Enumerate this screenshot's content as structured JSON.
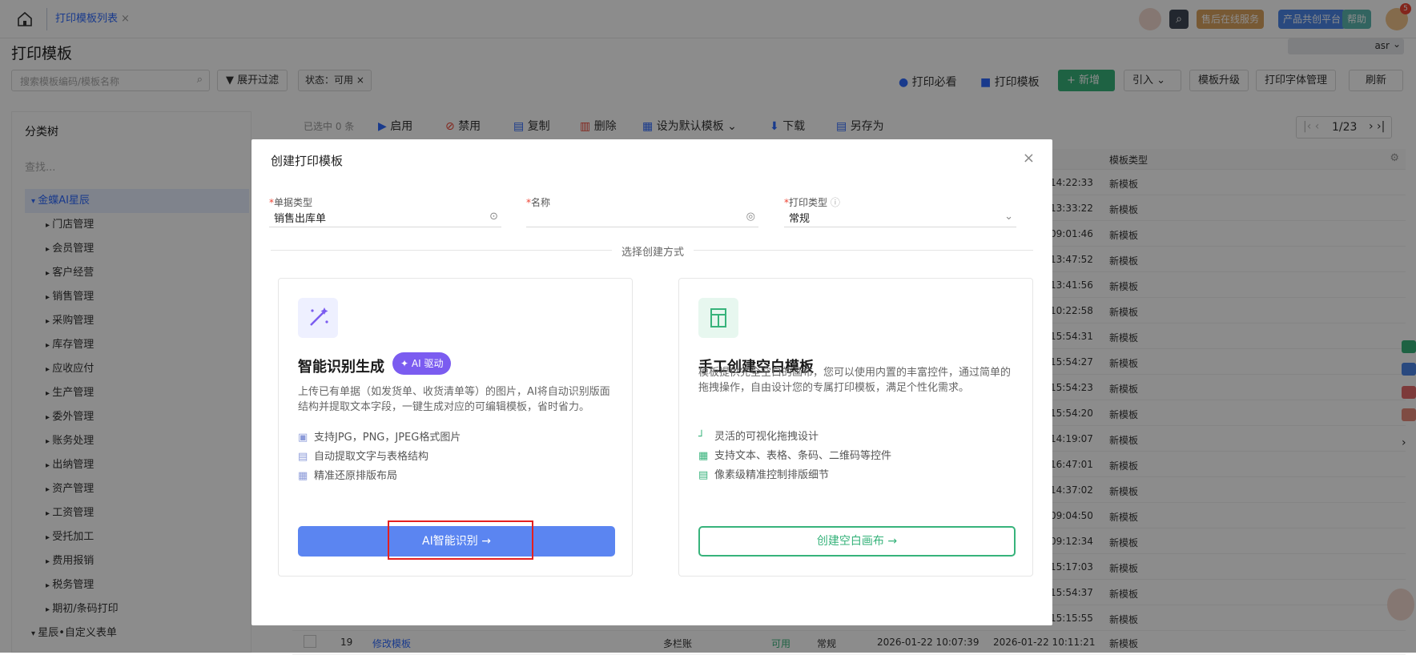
{
  "topbar": {
    "tab_label": "打印模板列表",
    "tab_close": "×",
    "buttons": [
      {
        "label": "售后在线服务",
        "color": "#d9a260"
      },
      {
        "label": "产品共创平台",
        "color": "#4b86e8"
      },
      {
        "label": "帮助",
        "color": "#5bb6b0"
      }
    ],
    "notification_count": "5"
  },
  "page": {
    "title": "打印模板",
    "user_name": "asr"
  },
  "filter": {
    "search_placeholder": "搜索模板编码/模板名称",
    "expand_label": "展开过滤",
    "status_tag": "状态：可用",
    "tag_close": "×"
  },
  "actions": {
    "must_see": "打印必看",
    "print_template": "打印模板",
    "add": "新增",
    "import": "引入",
    "upgrade": "模板升级",
    "font_manage": "打印字体管理",
    "refresh": "刷新"
  },
  "sidebar": {
    "title": "分类树",
    "search_placeholder": "查找...",
    "items": [
      {
        "label": "金蝶AI星辰",
        "level": 0,
        "selected": true
      },
      {
        "label": "门店管理",
        "level": 1
      },
      {
        "label": "会员管理",
        "level": 1
      },
      {
        "label": "客户经营",
        "level": 1
      },
      {
        "label": "销售管理",
        "level": 1
      },
      {
        "label": "采购管理",
        "level": 1
      },
      {
        "label": "库存管理",
        "level": 1
      },
      {
        "label": "应收应付",
        "level": 1
      },
      {
        "label": "生产管理",
        "level": 1
      },
      {
        "label": "委外管理",
        "level": 1
      },
      {
        "label": "账务处理",
        "level": 1
      },
      {
        "label": "出纳管理",
        "level": 1
      },
      {
        "label": "资产管理",
        "level": 1
      },
      {
        "label": "工资管理",
        "level": 1
      },
      {
        "label": "受托加工",
        "level": 1
      },
      {
        "label": "费用报销",
        "level": 1
      },
      {
        "label": "税务管理",
        "level": 1
      },
      {
        "label": "期初/条码打印",
        "level": 1
      },
      {
        "label": "星辰•自定义表单",
        "level": 0
      }
    ]
  },
  "table_toolbar": {
    "selected": "已选中 0 条",
    "enable": "启用",
    "disable": "禁用",
    "copy": "复制",
    "delete": "删除",
    "set_default": "设为默认模板",
    "download": "下载",
    "save_as": "另存为",
    "page_indicator": "1/23"
  },
  "table": {
    "header_type": "模板类型",
    "rows": [
      {
        "time": "14:22:33",
        "type": "新模板"
      },
      {
        "time": "13:33:22",
        "type": "新模板"
      },
      {
        "time": "09:01:46",
        "type": "新模板"
      },
      {
        "time": "13:47:52",
        "type": "新模板"
      },
      {
        "time": "13:41:56",
        "type": "新模板"
      },
      {
        "time": "10:22:58",
        "type": "新模板"
      },
      {
        "time": "15:54:31",
        "type": "新模板"
      },
      {
        "time": "15:54:27",
        "type": "新模板"
      },
      {
        "time": "15:54:23",
        "type": "新模板"
      },
      {
        "time": "15:54:20",
        "type": "新模板"
      },
      {
        "time": "14:19:07",
        "type": "新模板"
      },
      {
        "time": "16:47:01",
        "type": "新模板"
      },
      {
        "time": "14:37:02",
        "type": "新模板"
      },
      {
        "time": "09:04:50",
        "type": "新模板"
      },
      {
        "time": "09:12:34",
        "type": "新模板"
      },
      {
        "time": "15:17:03",
        "type": "新模板"
      },
      {
        "time": "15:54:37",
        "type": "新模板"
      },
      {
        "time": "15:15:55",
        "type": "新模板"
      }
    ],
    "last_row": {
      "index": "19",
      "name": "修改模板",
      "category": "多栏账",
      "status": "可用",
      "print_type": "常规",
      "created": "2026-01-22 10:07:39",
      "updated": "2026-01-22 10:11:21",
      "type": "新模板"
    }
  },
  "modal": {
    "title": "创建打印模板",
    "close": "×",
    "fields": {
      "doc_type_label": "单据类型",
      "doc_type_value": "销售出库单",
      "name_label": "名称",
      "name_value": "",
      "print_type_label": "打印类型",
      "print_type_value": "常规"
    },
    "required_mark": "*",
    "divider_text": "选择创建方式",
    "ai_card": {
      "title": "智能识别生成",
      "badge": "AI 驱动",
      "desc": "上传已有单据（如发货单、收货清单等）的图片，AI将自动识别版面结构并提取文本字段，一键生成对应的可编辑模板，省时省力。",
      "features": [
        "支持JPG，PNG，JPEG格式图片",
        "自动提取文字与表格结构",
        "精准还原排版布局"
      ],
      "button": "AI智能识别"
    },
    "manual_card": {
      "title": "手工创建空白模板",
      "desc": "模板提供完全空白的画布，您可以使用内置的丰富控件，通过简单的拖拽操作，自由设计您的专属打印模板，满足个性化需求。",
      "features": [
        "灵活的可视化拖拽设计",
        "支持文本、表格、条码、二维码等控件",
        "像素级精准控制排版细节"
      ],
      "button": "创建空白画布"
    }
  }
}
